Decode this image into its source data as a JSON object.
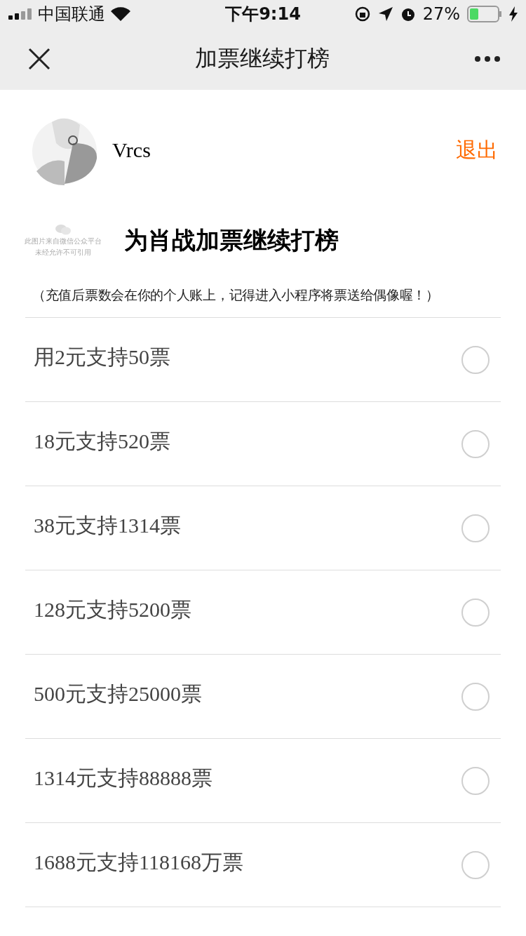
{
  "status_bar": {
    "carrier": "中国联通",
    "time": "下午9:14",
    "battery": "27%"
  },
  "nav": {
    "title": "加票继续打榜"
  },
  "user": {
    "name": "Vrcs",
    "logout": "退出"
  },
  "banner": {
    "placeholder_lines": [
      "此图片来自微信公众平台",
      "未经允许不可引用"
    ],
    "title": "为肖战加票继续打榜"
  },
  "note": "（充值后票数会在你的个人账上，记得进入小程序将票送给偶像喔！）",
  "options": [
    {
      "label": "用2元支持50票",
      "selected": false
    },
    {
      "label": "18元支持520票",
      "selected": false
    },
    {
      "label": "38元支持1314票",
      "selected": false
    },
    {
      "label": "128元支持5200票",
      "selected": false
    },
    {
      "label": "500元支持25000票",
      "selected": false
    },
    {
      "label": "1314元支持88888票",
      "selected": false
    },
    {
      "label": "1688元支持118168万票",
      "selected": false
    }
  ]
}
